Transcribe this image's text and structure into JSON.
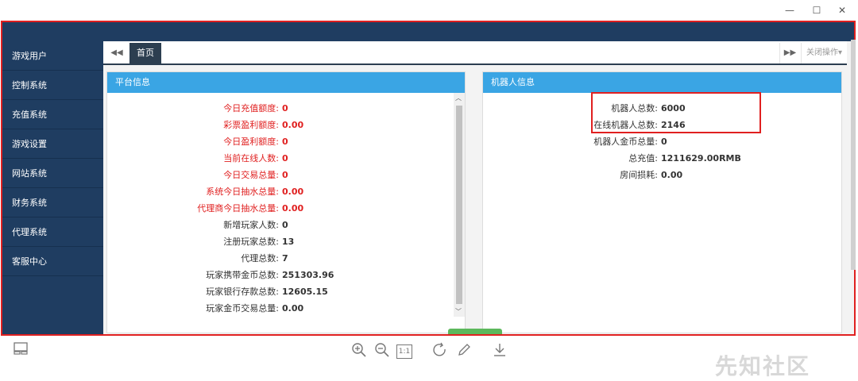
{
  "window": {
    "minimize_icon": "minimize-icon",
    "maximize_icon": "maximize-icon",
    "close_icon": "close-icon",
    "minimize": "—",
    "maximize": "☐",
    "close": "✕"
  },
  "sidebar": {
    "items": [
      {
        "label": "游戏用户"
      },
      {
        "label": "控制系统"
      },
      {
        "label": "充值系统"
      },
      {
        "label": "游戏设置"
      },
      {
        "label": "网站系统"
      },
      {
        "label": "财务系统"
      },
      {
        "label": "代理系统"
      },
      {
        "label": "客服中心"
      }
    ]
  },
  "tabs": {
    "back_icon": "double-left-arrow-icon",
    "back_glyph": "◀◀",
    "home": "首页",
    "forward_icon": "double-right-arrow-icon",
    "forward_glyph": "▶▶",
    "close_ops": "关闭操作▾"
  },
  "platform": {
    "title": "平台信息",
    "rows": [
      {
        "label": "今日充值额度:",
        "value": "0",
        "red": true
      },
      {
        "label": "彩票盈利额度:",
        "value": "0.00",
        "red": true
      },
      {
        "label": "今日盈利额度:",
        "value": "0",
        "red": true
      },
      {
        "label": "当前在线人数:",
        "value": "0",
        "red": true
      },
      {
        "label": "今日交易总量:",
        "value": "0",
        "red": true
      },
      {
        "label": "系统今日抽水总量:",
        "value": "0.00",
        "red": true
      },
      {
        "label": "代理商今日抽水总量:",
        "value": "0.00",
        "red": true
      },
      {
        "label": "新增玩家人数:",
        "value": "0",
        "red": false
      },
      {
        "label": "注册玩家总数:",
        "value": "13",
        "red": false
      },
      {
        "label": "代理总数:",
        "value": "7",
        "red": false
      },
      {
        "label": "玩家携带金币总数:",
        "value": "251303.96",
        "red": false
      },
      {
        "label": "玩家银行存款总数:",
        "value": "12605.15",
        "red": false
      },
      {
        "label": "玩家金币交易总量:",
        "value": "0.00",
        "red": false
      }
    ]
  },
  "robot": {
    "title": "机器人信息",
    "rows": [
      {
        "label": "机器人总数:",
        "value": "6000"
      },
      {
        "label": "在线机器人总数:",
        "value": "2146"
      },
      {
        "label": "机器人金币总量:",
        "value": "0"
      },
      {
        "label": "总充值:",
        "value": "1211629.00RMB"
      },
      {
        "label": "房间损耗:",
        "value": "0.00"
      }
    ]
  },
  "toolbar": {
    "layout_icon": "layout-icon",
    "zoom_in_icon": "zoom-in-icon",
    "zoom_out_icon": "zoom-out-icon",
    "actual_size_icon": "actual-size-icon",
    "actual_size": "1:1",
    "rotate_icon": "rotate-icon",
    "edit_icon": "pencil-icon",
    "download_icon": "download-icon"
  },
  "watermark": "先知社区",
  "colors": {
    "navy": "#1f3d61",
    "panel_header": "#3aa5e4",
    "highlight_red": "#e02020",
    "green": "#5cb85c"
  }
}
